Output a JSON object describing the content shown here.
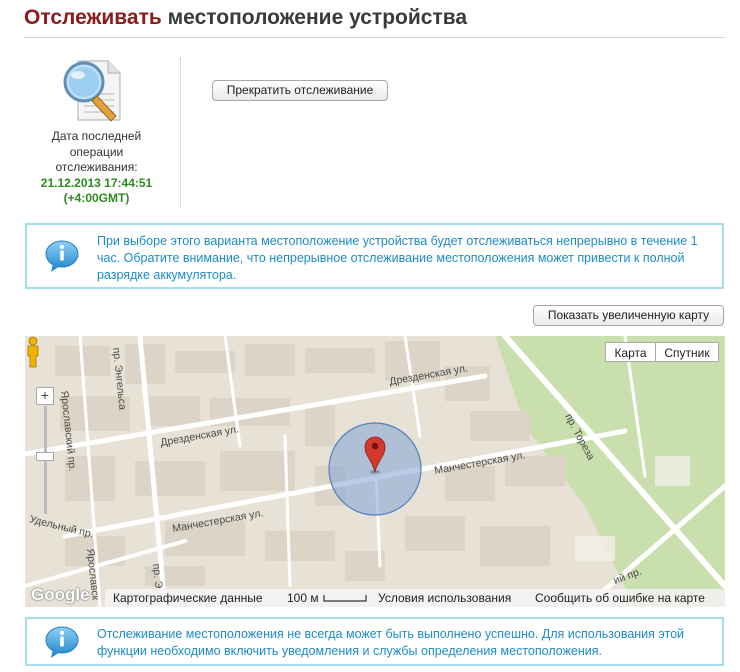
{
  "header": {
    "title_accent": "Отслеживать",
    "title_rest": " местоположение устройства"
  },
  "status": {
    "label_line1": "Дата последней",
    "label_line2": "операции",
    "label_line3": "отслеживания:",
    "datetime": "21.12.2013 17:44:51",
    "timezone": "(+4:00GMT)",
    "icon": "search-document-icon"
  },
  "actions": {
    "stop_label": "Прекратить отслеживание",
    "bigger_map_label": "Показать увеличенную карту"
  },
  "info_top": {
    "text": "При выборе этого варианта местоположение устройства будет отслеживаться непрерывно в течение 1 час. Обратите внимание, что непрерывное отслеживание местоположения может привести к полной разрядке аккумулятора.",
    "icon": "info-bubble-icon"
  },
  "info_bottom": {
    "text": "Отслеживание местоположения не всегда может быть выполнено успешно. Для использования этой функции необходимо включить уведомления и службы определения местоположения.",
    "icon": "info-bubble-icon"
  },
  "map": {
    "type_map_label": "Карта",
    "type_sat_label": "Спутник",
    "zoom_in_label": "+",
    "streets": {
      "dresdenskaya_1": "Дрезденская ул.",
      "dresdenskaya_2": "Дрезденская ул.",
      "manchesterskaya_1": "Манчестерская ул.",
      "manchesterskaya_2": "Манчестерская ул.",
      "engelsa": "пр. Энгельса",
      "yaroslavsky_1": "Ярославский пр.",
      "yaroslavsky_2": "Ярославск",
      "udelny": "Удельный пр.",
      "toreza": "пр. Тореза",
      "engelsa_short": "пр. Э",
      "bottom_right": "ий пр."
    },
    "footer": {
      "logo": "Google",
      "map_data": "Картографические данные",
      "scale": "100 м",
      "terms": "Условия использования",
      "report": "Сообщить об ошибке на карте"
    },
    "colors": {
      "land": "#e8e2d6",
      "block": "#dcd5c7",
      "road": "#ffffff",
      "park": "#c9dfae",
      "accuracy_circle": "#7fa3d6",
      "pin": "#d33a2c"
    }
  }
}
